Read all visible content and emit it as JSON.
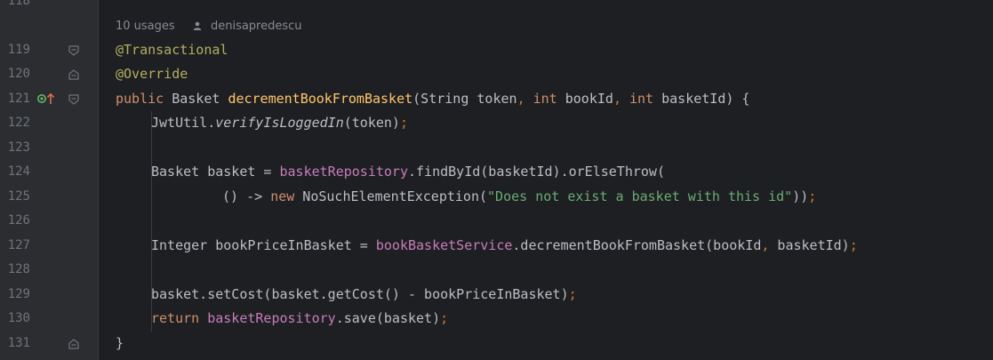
{
  "gutter": {
    "line_numbers": [
      "118",
      "119",
      "120",
      "121",
      "122",
      "123",
      "124",
      "125",
      "126",
      "127",
      "128",
      "129",
      "130",
      "131"
    ]
  },
  "inlay": {
    "usages": "10 usages",
    "author": "denisapredescu"
  },
  "code": {
    "l119": "@Transactional",
    "l120": "@Override",
    "l121": {
      "public": "public",
      "type": "Basket",
      "method": "decrementBookFromBasket",
      "params_a": "(String token",
      "comma1": ",",
      "int1": " int",
      "p2": " bookId",
      "comma2": ",",
      "int2": " int",
      "p3": " basketId) {"
    },
    "l122": {
      "cls": "JwtUtil.",
      "method": "verifyIsLoggedIn",
      "args": "(token)",
      "semi": ";"
    },
    "l124": {
      "decl": "Basket basket = ",
      "field": "basketRepository",
      "rest": ".findById(basketId).orElseThrow("
    },
    "l125": {
      "lambda": "() -> ",
      "new": "new",
      "ex": " NoSuchElementException(",
      "str": "\"Does not exist a basket with this id\"",
      "close": "))",
      "semi": ";"
    },
    "l127": {
      "decl": "Integer bookPriceInBasket = ",
      "field": "bookBasketService",
      "call": ".decrementBookFromBasket(bookId",
      "comma": ",",
      "rest": " basketId)",
      "semi": ";"
    },
    "l129": {
      "text": "basket.setCost(basket.getCost() - bookPriceInBasket)",
      "semi": ";"
    },
    "l130": {
      "ret": "return",
      "field": " basketRepository",
      "rest": ".save(basket)",
      "semi": ";"
    },
    "l131": "}"
  },
  "colors": {
    "keyword": "#cf8e6d",
    "annotation": "#b3ae60",
    "method_decl": "#ffc66d",
    "field": "#c77dbb",
    "string": "#6aab73",
    "text": "#bcbec4"
  }
}
